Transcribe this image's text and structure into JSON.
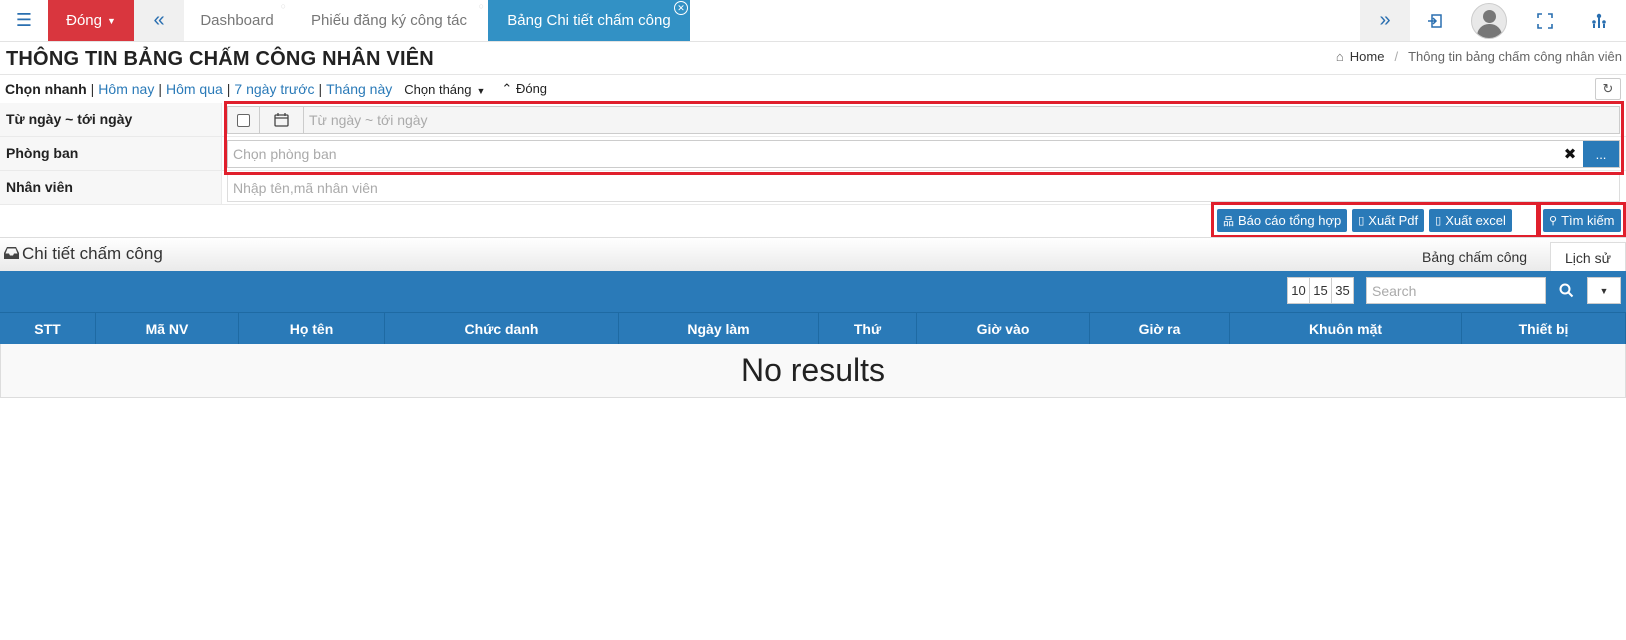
{
  "topbar": {
    "dong_label": "Đóng",
    "tabs": [
      {
        "label": "Dashboard"
      },
      {
        "label": "Phiếu đăng ký công tác"
      },
      {
        "label": "Bảng Chi tiết chấm công"
      }
    ]
  },
  "page": {
    "title": "THÔNG TIN BẢNG CHẤM CÔNG NHÂN VIÊN",
    "breadcrumb": {
      "home": "Home",
      "current": "Thông tin bảng chấm công nhân viên"
    }
  },
  "quick": {
    "label": "Chọn nhanh",
    "links": [
      "Hôm nay",
      "Hôm qua",
      "7 ngày trước",
      "Tháng này"
    ],
    "choose_month": "Chọn tháng",
    "close": "Đóng"
  },
  "form": {
    "date_label": "Từ ngày ~ tới ngày",
    "date_placeholder": "Từ ngày ~ tới ngày",
    "dept_label": "Phòng ban",
    "dept_placeholder": "Chọn phòng ban",
    "dept_more": "...",
    "emp_label": "Nhân viên",
    "emp_placeholder": "Nhập tên,mã nhân viên"
  },
  "actions": {
    "report": "Báo cáo tổng hợp",
    "pdf": "Xuất Pdf",
    "excel": "Xuất excel",
    "search": "Tìm kiếm"
  },
  "section": {
    "title": "Chi tiết chấm công",
    "tabs": [
      "Bảng chấm công",
      "Lịch sử"
    ]
  },
  "table": {
    "page_sizes": [
      "10",
      "15",
      "35"
    ],
    "search_placeholder": "Search",
    "columns": [
      "STT",
      "Mã NV",
      "Họ tên",
      "Chức danh",
      "Ngày làm",
      "Thứ",
      "Giờ vào",
      "Giờ ra",
      "Khuôn mặt",
      "Thiết bị"
    ],
    "empty_text": "No results"
  },
  "colors": {
    "accent": "#2a7ab8",
    "danger": "#d9363e",
    "active_tab": "#3291c5",
    "highlight": "#e01f2c"
  }
}
